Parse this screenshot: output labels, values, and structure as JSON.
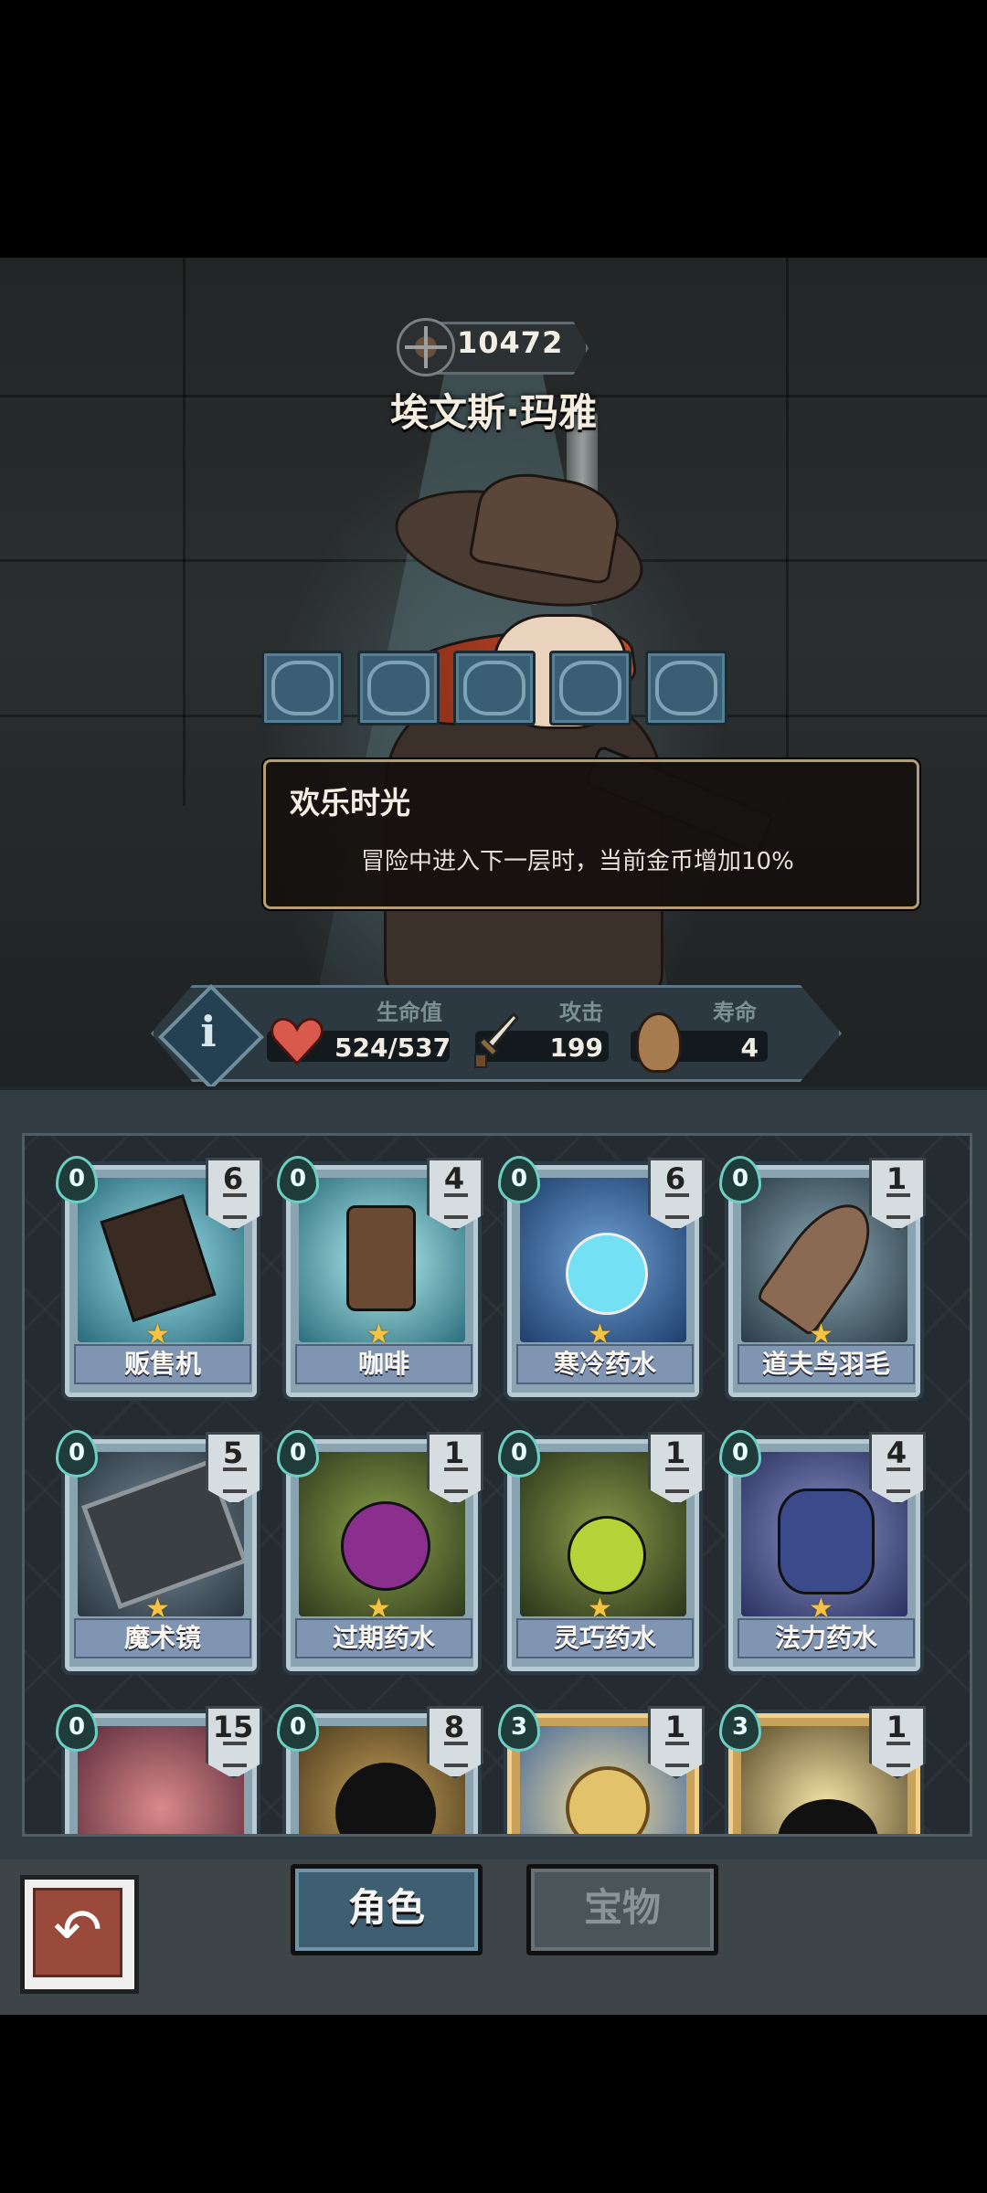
{
  "hero": {
    "score": "10472",
    "name": "埃文斯·玛雅"
  },
  "tooltip": {
    "title": "欢乐时光",
    "description": "冒险中进入下一层时，当前金币增加10%"
  },
  "skills": [
    "skill-1-icon",
    "skill-2-icon",
    "skill-3-icon",
    "skill-4-icon",
    "skill-5-icon"
  ],
  "stats": {
    "hp_label": "生命值",
    "hp_value": "524/537",
    "attack_label": "攻击",
    "attack_value": "199",
    "lifespan_label": "寿命",
    "lifespan_value": "4"
  },
  "items": [
    {
      "name": "贩售机",
      "cost": "0",
      "count": "6"
    },
    {
      "name": "咖啡",
      "cost": "0",
      "count": "4"
    },
    {
      "name": "寒冷药水",
      "cost": "0",
      "count": "6"
    },
    {
      "name": "道夫鸟羽毛",
      "cost": "0",
      "count": "1"
    },
    {
      "name": "魔术镜",
      "cost": "0",
      "count": "5"
    },
    {
      "name": "过期药水",
      "cost": "0",
      "count": "1"
    },
    {
      "name": "灵巧药水",
      "cost": "0",
      "count": "1"
    },
    {
      "name": "法力药水",
      "cost": "0",
      "count": "4"
    },
    {
      "name": "",
      "cost": "0",
      "count": "15"
    },
    {
      "name": "",
      "cost": "0",
      "count": "8"
    },
    {
      "name": "",
      "cost": "3",
      "count": "1"
    },
    {
      "name": "",
      "cost": "3",
      "count": "1"
    }
  ],
  "tabs": {
    "character": "角色",
    "treasure": "宝物"
  },
  "colors": {
    "accent": "#3e5f72",
    "card_label": "#7f95b1",
    "star": "#f5c343",
    "tooltip_border": "#b59c74"
  }
}
